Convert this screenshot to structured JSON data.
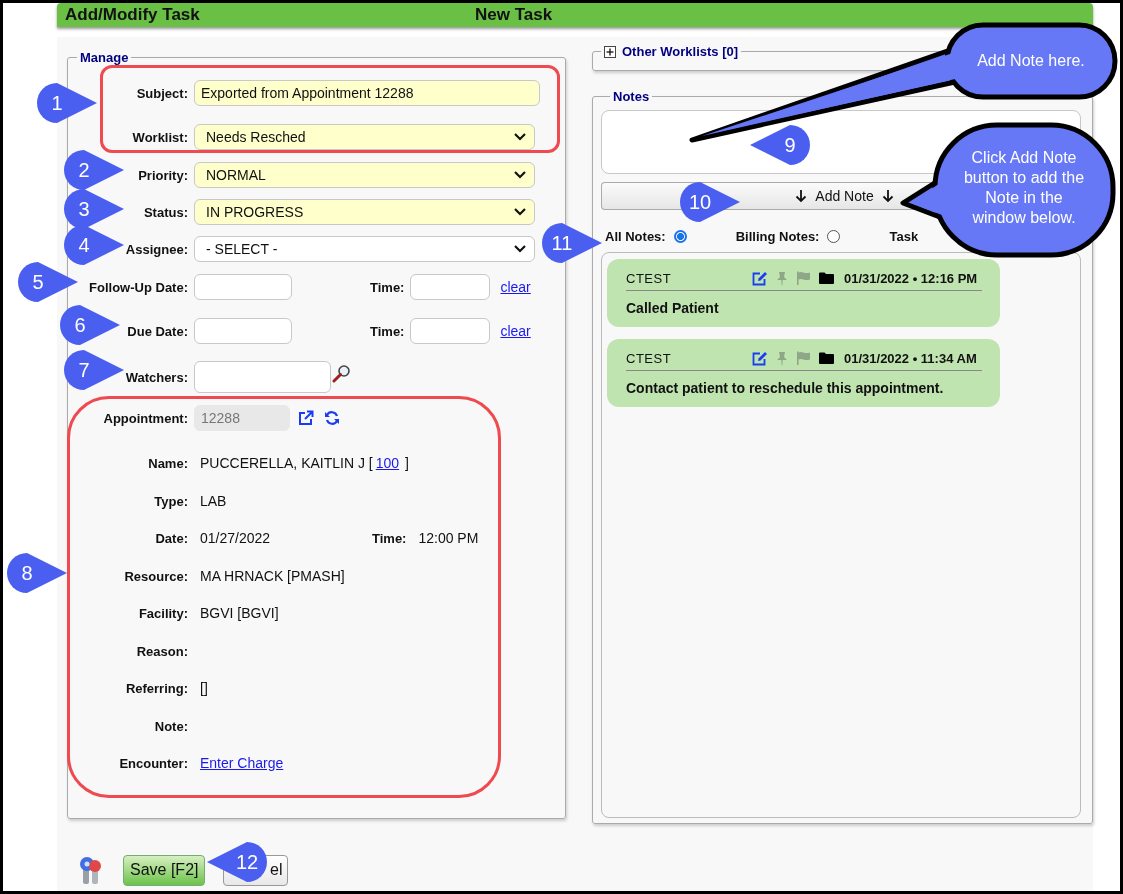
{
  "header": {
    "title": "Add/Modify Task",
    "subtitle": "New Task"
  },
  "manage": {
    "legend": "Manage",
    "fields": [
      {
        "kind": "text",
        "label": "Subject:",
        "value": "Exported from Appointment 12288",
        "highlighted": true
      },
      {
        "kind": "select",
        "label": "Worklist:",
        "value": "Needs Resched",
        "highlighted": true
      },
      {
        "kind": "select",
        "label": "Priority:",
        "value": "NORMAL",
        "highlighted": true
      },
      {
        "kind": "select",
        "label": "Status:",
        "value": "IN PROGRESS",
        "highlighted": true
      },
      {
        "kind": "select",
        "label": "Assignee:",
        "value": "- SELECT -",
        "highlighted": false
      },
      {
        "kind": "datetime",
        "label": "Follow-Up Date:",
        "time_label": "Time:",
        "link": "clear"
      },
      {
        "kind": "datetime",
        "label": "Due Date:",
        "time_label": "Time:",
        "link": "clear"
      },
      {
        "kind": "lookup",
        "label": "Watchers:"
      },
      {
        "kind": "appointment",
        "label": "Appointment:",
        "value": "12288",
        "disabled": true
      }
    ],
    "details": [
      {
        "kind": "name",
        "label": "Name:",
        "value": "PUCCERELLA, KAITLIN J [",
        "link": "100",
        "suffix": "]"
      },
      {
        "kind": "text",
        "label": "Type:",
        "value": "LAB"
      },
      {
        "kind": "datetime",
        "label": "Date:",
        "value": "01/27/2022",
        "time_label": "Time:",
        "time": "12:00 PM"
      },
      {
        "kind": "text",
        "label": "Resource:",
        "value": "MA HRNACK [PMASH]"
      },
      {
        "kind": "text",
        "label": "Facility:",
        "value": "BGVI [BGVI]"
      },
      {
        "kind": "text",
        "label": "Reason:"
      },
      {
        "kind": "text",
        "label": "Referring:",
        "value": "[]"
      },
      {
        "kind": "text",
        "label": "Note:"
      },
      {
        "kind": "link",
        "label": "Encounter:",
        "link": "Enter Charge"
      }
    ]
  },
  "other_worklists": {
    "label": "Other Worklists [0]",
    "expanded": false
  },
  "notes": {
    "legend": "Notes",
    "add_button": "Add Note",
    "filters": [
      {
        "label": "All Notes:",
        "selected": true
      },
      {
        "label": "Billing Notes:",
        "selected": false
      }
    ],
    "task_filter_label": "Task",
    "entries": [
      {
        "author": "CTEST",
        "timestamp": "01/31/2022 • 12:16 PM",
        "text": "Called Patient",
        "pinned": false,
        "flagged": false
      },
      {
        "author": "CTEST",
        "timestamp": "01/31/2022 • 11:34 AM",
        "text": "Contact patient to reschedule this appointment.",
        "pinned": false,
        "flagged": false
      }
    ]
  },
  "footer": {
    "save": "Save [F2]",
    "cancel_visible": "el"
  },
  "annotations": {
    "markers": [
      {
        "number": "1"
      },
      {
        "number": "2"
      },
      {
        "number": "3"
      },
      {
        "number": "4"
      },
      {
        "number": "5"
      },
      {
        "number": "6"
      },
      {
        "number": "7"
      },
      {
        "number": "8"
      },
      {
        "number": "9"
      },
      {
        "number": "10"
      },
      {
        "number": "11"
      },
      {
        "number": "12"
      }
    ],
    "callouts": [
      {
        "lines": [
          "Add Note here."
        ]
      },
      {
        "lines": [
          "Click Add Note",
          "button to add the",
          "Note in the",
          "window below."
        ]
      }
    ]
  }
}
